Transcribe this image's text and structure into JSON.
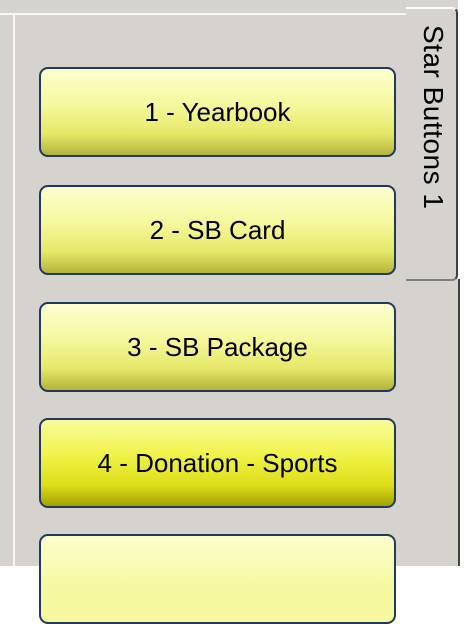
{
  "tab": {
    "label": "Star Buttons 1"
  },
  "buttons": [
    {
      "label": "1 - Yearbook"
    },
    {
      "label": "2 - SB Card"
    },
    {
      "label": "3 - SB Package"
    },
    {
      "label": "4 - Donation - Sports"
    },
    {
      "label": ""
    }
  ],
  "colors": {
    "panel_background": "#d6d3ce",
    "button_border": "#223a5a",
    "button_yellow_light": "#f6f89f",
    "button_yellow_strong": "#f0f34a"
  }
}
